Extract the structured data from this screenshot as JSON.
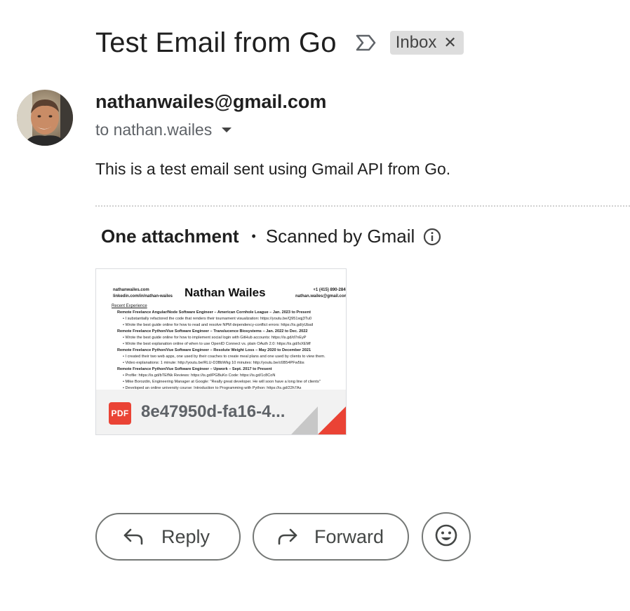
{
  "email": {
    "subject": "Test Email from Go",
    "label": "Inbox",
    "sender_email": "nathanwailes@gmail.com",
    "recipient_text": "to nathan.wailes",
    "body": "This is a test email sent using Gmail API from Go."
  },
  "attachments": {
    "count_label": "One attachment",
    "scanned_label": "Scanned by Gmail",
    "file": {
      "type_badge": "PDF",
      "name": "8e47950d-fa16-4...",
      "preview": {
        "contact_left": [
          "nathanwailes.com",
          "linkedin.com/in/nathan-wailes"
        ],
        "name": "Nathan Wailes",
        "contact_right": [
          "+1 (415) 890-2845",
          "nathan.wailes@gmail.com"
        ],
        "section": "Recent Experience",
        "lines": [
          {
            "t": "Remote Freelance Angular/Node Software Engineer – American Cornhole League – Jan. 2023 to Present",
            "k": "h"
          },
          {
            "t": "• I substantially refactored the code that renders their tournament visualization: https://youtu.be/Q951xqj3Tu0",
            "k": "b"
          },
          {
            "t": "• Wrote the best guide online for how to read and resolve NPM dependency-conflict errors: https://is.gd/yUbail",
            "k": "b"
          },
          {
            "t": "Remote Freelance Python/Vue Software Engineer – Translucence Biosystems – Jan. 2022 to Dec. 2022",
            "k": "h"
          },
          {
            "t": "• Wrote the best guide online for how to implement social login with GitHub accounts: https://is.gd/d7nEyP",
            "k": "b"
          },
          {
            "t": "• Wrote the best explanation online of when to use OpenID Connect vs. plain OAuth 2.0: https://is.gd/IxXEMf",
            "k": "b"
          },
          {
            "t": "Remote Freelance Python/Vue Software Engineer – Resolute Weight Loss – May 2020 to December 2021",
            "k": "h"
          },
          {
            "t": "• I created their two web apps, one used by their coaches to create meal plans and one used by clients to view them.",
            "k": "b"
          },
          {
            "t": "• Video explanations: 1 minute: http://youtu.be/RLU-D3BbWkg 10 minutes: http://youtu.be/c6B54PFw5bs",
            "k": "b"
          },
          {
            "t": "Remote Freelance Python/Vue Software Engineer – Upwork – Sept. 2017 to Present",
            "k": "h"
          },
          {
            "t": "• Profile: https://is.gd/bTEfNk      Reviews: https://is.gd/PGBuKo      Code: https://is.gd/1c8CoN",
            "k": "b"
          },
          {
            "t": "• Mike Borozdin, Engineering Manager at Google: \"Really great developer. He will soon have a long line of clients\"",
            "k": "b"
          },
          {
            "t": "• Developed an online university course: Introduction to Programming with Python: https://is.gd/22h7As",
            "k": "b"
          }
        ]
      }
    }
  },
  "actions": {
    "reply": "Reply",
    "forward": "Forward"
  },
  "colors": {
    "pdf_red": "#ea4335",
    "chip_bg": "#dddddd",
    "button_border": "#747775"
  },
  "icons": [
    "important-marker-icon",
    "close-icon",
    "chevron-down-icon",
    "info-icon",
    "pdf-icon",
    "reply-icon",
    "forward-icon",
    "emoji-icon"
  ]
}
